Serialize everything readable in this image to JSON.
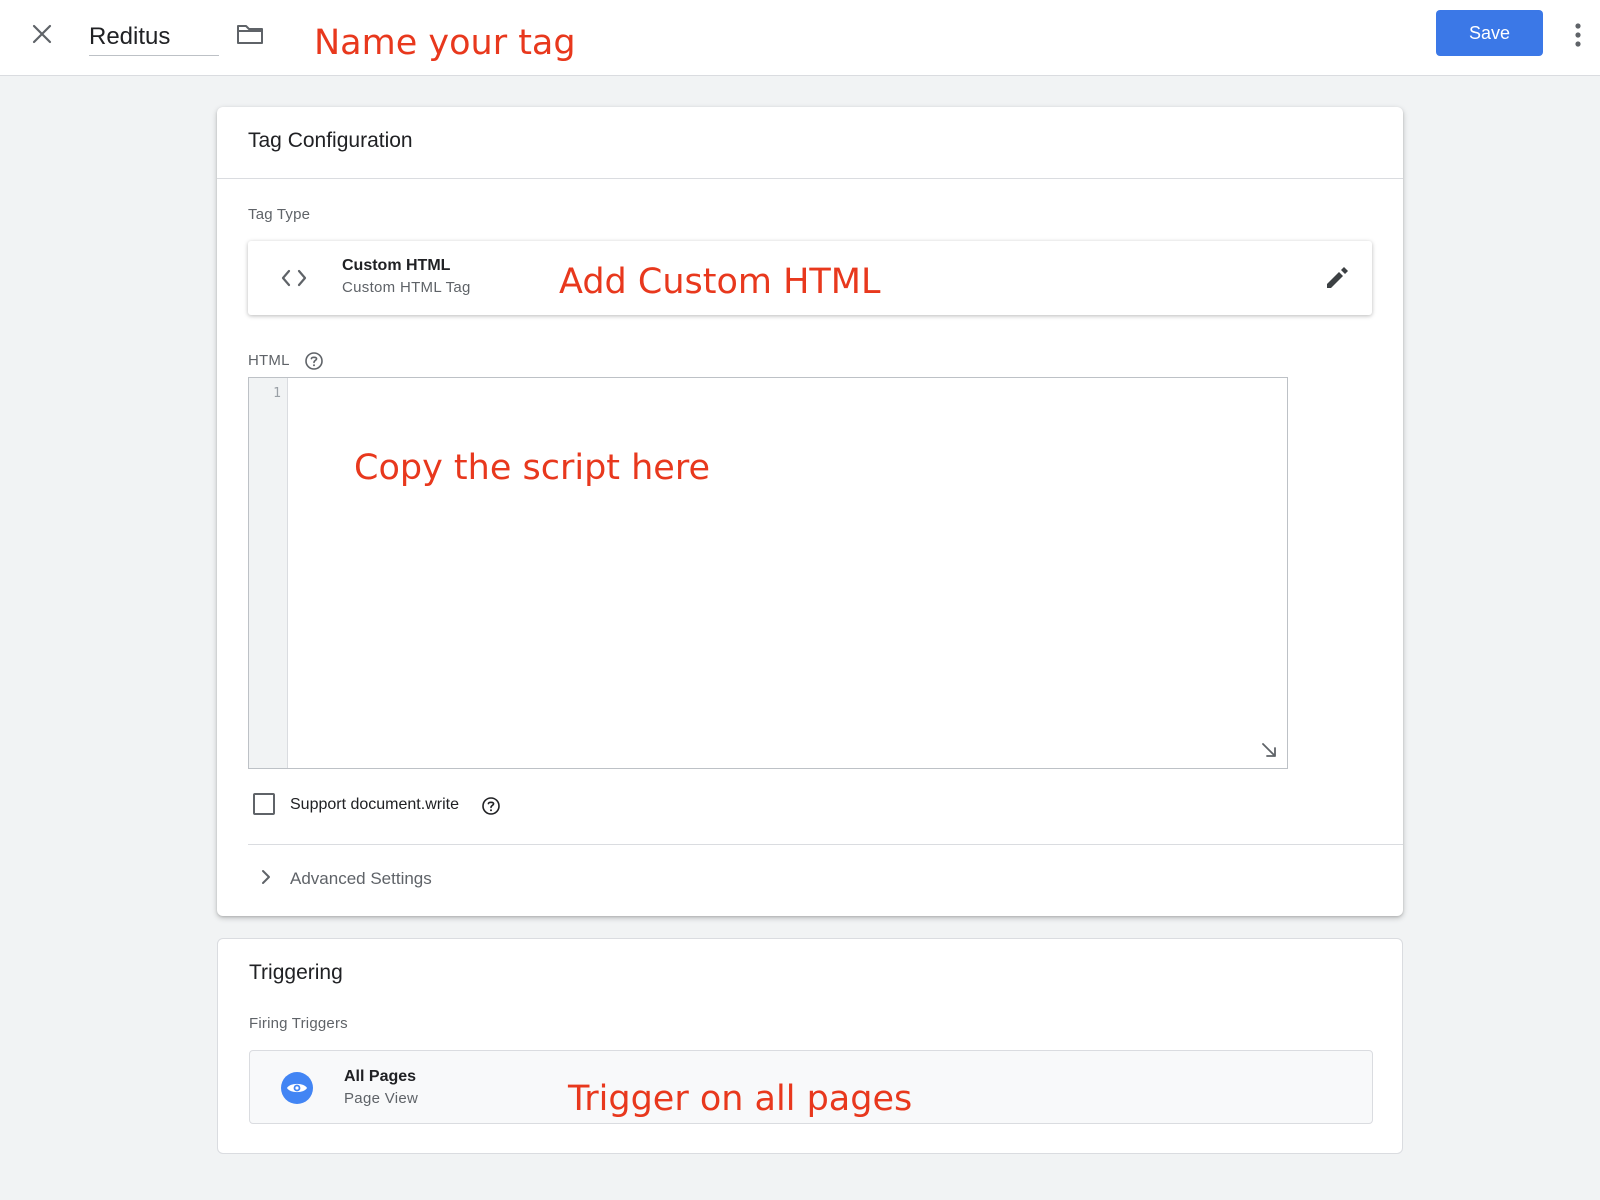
{
  "header": {
    "tag_name": "Reditus",
    "save_label": "Save",
    "annotation": "Name your tag"
  },
  "config": {
    "title": "Tag Configuration",
    "tag_type_label": "Tag Type",
    "tag_type": {
      "name": "Custom HTML",
      "subtitle": "Custom HTML Tag",
      "icon": "code-icon"
    },
    "annotation_type": "Add Custom HTML",
    "html_label": "HTML",
    "editor": {
      "line_number": "1",
      "value": ""
    },
    "annotation_editor": "Copy the script here",
    "support_document_write": {
      "label": "Support document.write",
      "checked": false
    },
    "advanced_label": "Advanced Settings"
  },
  "triggering": {
    "title": "Triggering",
    "firing_label": "Firing Triggers",
    "trigger": {
      "name": "All Pages",
      "subtitle": "Page View",
      "icon": "eye-icon"
    },
    "annotation": "Trigger on all pages"
  },
  "colors": {
    "accent": "#3b78e7",
    "annotation": "#e8381d",
    "trigger_icon_bg": "#4285f4"
  }
}
